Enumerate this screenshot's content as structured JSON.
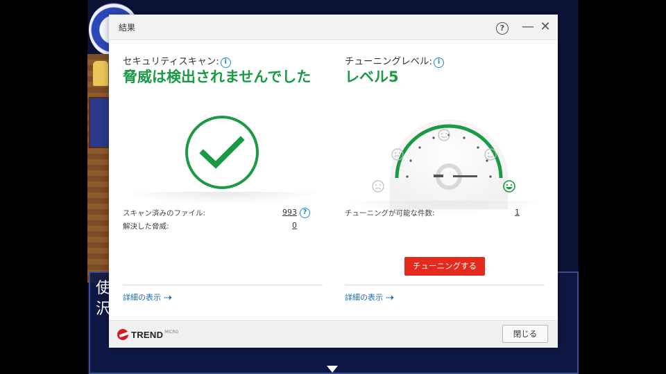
{
  "background_game": {
    "dialog_text_line1": "使",
    "dialog_text_line2": "沢"
  },
  "window": {
    "title": "結果",
    "help_icon": "help-circle-icon",
    "help_glyph": "?",
    "minimize_glyph": "—",
    "close_glyph": "✕"
  },
  "security_scan": {
    "label": "セキュリティスキャン:",
    "info_glyph": "i",
    "result": "脅威は検出されませんでした",
    "result_icon": "check-circle-icon",
    "color_green": "#1a9a45",
    "stats": [
      {
        "label": "スキャン済みのファイル:",
        "value": "993"
      },
      {
        "label": "解決した脅威:",
        "value": "0"
      }
    ],
    "stat_help_glyph": "?",
    "details_link": "詳細の表示",
    "details_arrow": "⇢"
  },
  "tuning": {
    "label": "チューニングレベル:",
    "info_glyph": "i",
    "level": "レベル5",
    "gauge_level": 5,
    "gauge_max": 5,
    "stats": [
      {
        "label": "チューニングが可能な件数:",
        "value": "1"
      }
    ],
    "tune_button": "チューニングする",
    "tune_button_color": "#e42a1d",
    "details_link": "詳細の表示",
    "details_arrow": "⇢"
  },
  "footer": {
    "brand": "TREND",
    "brand_sub": "MICRO",
    "close_button": "閉じる"
  }
}
